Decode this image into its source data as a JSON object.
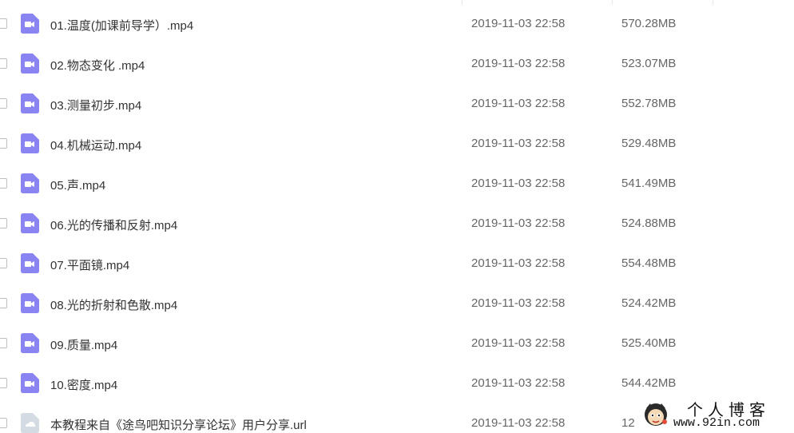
{
  "files": [
    {
      "name": "01.温度(加课前导学）.mp4",
      "date": "2019-11-03 22:58",
      "size": "570.28MB",
      "type": "video",
      "icon": "video-file-icon"
    },
    {
      "name": "02.物态变化 .mp4",
      "date": "2019-11-03 22:58",
      "size": "523.07MB",
      "type": "video",
      "icon": "video-file-icon"
    },
    {
      "name": "03.测量初步.mp4",
      "date": "2019-11-03 22:58",
      "size": "552.78MB",
      "type": "video",
      "icon": "video-file-icon"
    },
    {
      "name": "04.机械运动.mp4",
      "date": "2019-11-03 22:58",
      "size": "529.48MB",
      "type": "video",
      "icon": "video-file-icon"
    },
    {
      "name": "05.声.mp4",
      "date": "2019-11-03 22:58",
      "size": "541.49MB",
      "type": "video",
      "icon": "video-file-icon"
    },
    {
      "name": "06.光的传播和反射.mp4",
      "date": "2019-11-03 22:58",
      "size": "524.88MB",
      "type": "video",
      "icon": "video-file-icon"
    },
    {
      "name": "07.平面镜.mp4",
      "date": "2019-11-03 22:58",
      "size": "554.48MB",
      "type": "video",
      "icon": "video-file-icon"
    },
    {
      "name": "08.光的折射和色散.mp4",
      "date": "2019-11-03 22:58",
      "size": "524.42MB",
      "type": "video",
      "icon": "video-file-icon"
    },
    {
      "name": "09.质量.mp4",
      "date": "2019-11-03 22:58",
      "size": "525.40MB",
      "type": "video",
      "icon": "video-file-icon"
    },
    {
      "name": "10.密度.mp4",
      "date": "2019-11-03 22:58",
      "size": "544.42MB",
      "type": "video",
      "icon": "video-file-icon"
    },
    {
      "name": "本教程来自《途鸟吧知识分享论坛》用户分享.url",
      "date": "2019-11-03 22:58",
      "size": "12",
      "type": "url",
      "icon": "url-file-icon"
    }
  ],
  "watermark": {
    "title": "个人博客",
    "url": "www.92in.com"
  },
  "colors": {
    "video_icon": "#8a84f2",
    "url_icon": "#d5dbe3",
    "name_text": "#333333",
    "meta_text": "#666666"
  }
}
